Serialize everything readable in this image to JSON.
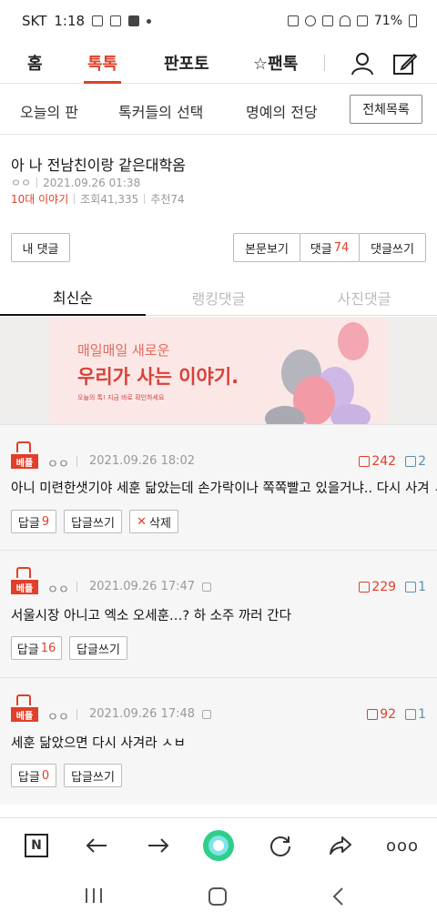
{
  "status": {
    "carrier": "SKT",
    "time": "1:18",
    "battery": "71%"
  },
  "topnav": {
    "tabs": [
      "홈",
      "톡톡",
      "판포토",
      "☆팬톡"
    ],
    "active": "톡톡"
  },
  "subnav": {
    "items": [
      "오늘의 판",
      "톡커들의 선택",
      "명예의 전당"
    ],
    "all_button": "전체목록"
  },
  "post": {
    "title": "아 나 전남친이랑 같은대학옴",
    "author": "ㅇㅇ",
    "date": "2021.09.26 01:38",
    "category": "10대 이야기",
    "views": "조회41,335",
    "recommends": "추천74"
  },
  "actions": {
    "my_comments": "내 댓글",
    "view_post": "본문보기",
    "comments_label": "댓글",
    "comments_count": "74",
    "write_comment": "댓글쓰기"
  },
  "sort_tabs": [
    "최신순",
    "랭킹댓글",
    "사진댓글"
  ],
  "banner": {
    "line1": "매일매일 새로운",
    "line2": "우리가 사는 이야기.",
    "line3": "오늘의 톡! 지금 바로 확인하세요"
  },
  "comments": [
    {
      "badge": "베플",
      "user": "ㅇㅇ",
      "date": "2021.09.26 18:02",
      "up": "242",
      "down": "2",
      "text": "아니 미련한샛기야 세훈 닮았는데 손가락이나 쪽쪽빨고 있을거냐.. 다시 사겨 ㅅㅂ",
      "reply_label": "답글",
      "reply_count": "9",
      "write_reply": "답글쓰기",
      "delete": "삭제"
    },
    {
      "badge": "베플",
      "user": "ㅇㅇ",
      "date": "2021.09.26 17:47",
      "up": "229",
      "down": "1",
      "text": "서울시장 아니고 엑소 오세훈…? 하 소주 까러 간다",
      "reply_label": "답글",
      "reply_count": "16",
      "write_reply": "답글쓰기"
    },
    {
      "badge": "베플",
      "user": "ㅇㅇ",
      "date": "2021.09.26 17:48",
      "up": "92",
      "down": "1",
      "text": "세훈 닮았으면 다시 사겨라 ㅅㅂ",
      "reply_label": "답글",
      "reply_count": "0",
      "write_reply": "답글쓰기"
    }
  ],
  "browser_bar": {
    "n_label": "N",
    "more": "ooo"
  },
  "colors": {
    "accent": "#e0402a",
    "down": "#5a8fb0"
  }
}
